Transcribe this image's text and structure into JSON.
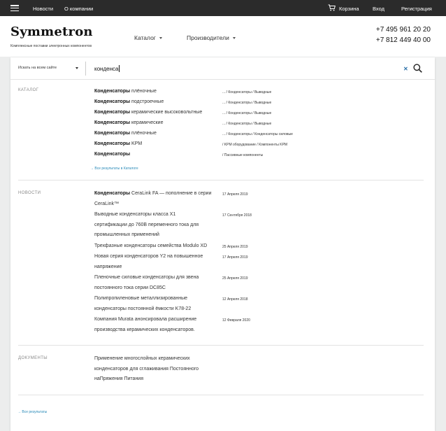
{
  "topbar": {
    "news": "Новости",
    "about": "О компании",
    "cart": "Корзина",
    "login": "Вход",
    "register": "Регистрация"
  },
  "header": {
    "logo": "Symmetron",
    "tagline": "Комплексные поставки электронных компонентов",
    "nav_catalog": "Каталог",
    "nav_manufacturers": "Производители",
    "phone1": "+7 495 961 20 20",
    "phone2": "+7 812 449 40 00"
  },
  "search": {
    "scope": "Искать на всем сайте",
    "query": "конденса"
  },
  "catalog": {
    "label": "КАТАЛОГ",
    "items": [
      {
        "bold": "Конденсаторы",
        "rest": " плёночные",
        "path": "... / Конденсаторы / Выводные"
      },
      {
        "bold": "Конденсаторы",
        "rest": " подстроечные",
        "path": "... / Конденсаторы / Выводные"
      },
      {
        "bold": "Конденсаторы",
        "rest": " керамические высоковольтные",
        "path": "... / Конденсаторы / Выводные"
      },
      {
        "bold": "Конденсаторы",
        "rest": " керамические",
        "path": "... / Конденсаторы / Выводные"
      },
      {
        "bold": "Конденсаторы",
        "rest": " плёночные",
        "path": "... / Конденсаторы / Конденсаторы силовые"
      },
      {
        "bold": "Конденсаторы",
        "rest": " KPM",
        "path": "/ KPM оборудование / Компоненты KPM"
      },
      {
        "bold": "Конденсаторы",
        "rest": "",
        "path": "/ Пассивные компоненты"
      }
    ],
    "all_link": "→ Все результаты в Каталоге"
  },
  "news": {
    "label": "НОВОСТИ",
    "items": [
      {
        "l1a": "Конденсаторы",
        "l1b": " CeraLink FA — пополнение в серии",
        "l2": "CeraLink™",
        "date": "17 Апреля 2019"
      },
      {
        "l1": "Выводные конденсаторы класса X1",
        "l2": "сертификации до 760В переменного тока для",
        "l3": "промышленных применений",
        "date": "17 Сентября 2018"
      },
      {
        "l1": "Трехфазные конденсаторы семейства Modulo XD",
        "date": "25 Апреля 2019"
      },
      {
        "l1": "Новая серия конденсаторов Y2 на повышенное",
        "l2": "напряжение",
        "date": "17 Апреля 2019"
      },
      {
        "l1": "Пленочные силовые конденсаторы для звена",
        "l2": "постоянного тока серии DC85C",
        "date": "25 Апреля 2019"
      },
      {
        "l1": "Полипропиленовые металлизированные",
        "l2": "конденсаторы постоянной ёмкости K78-22",
        "date": "12 Апреля 2018"
      },
      {
        "l1": "Компания Murata анонсировала расширение",
        "l2": "производства керамических конденсаторов.",
        "date": "12 Февраля 2020"
      }
    ]
  },
  "documents": {
    "label": "ДОКУМЕНТЫ",
    "l1": "Применение многослойных керамических",
    "l2": "конденсаторов для сглаживания Постоянного",
    "l3": "наПряжения Питания"
  },
  "all_results": "→ Все результаты",
  "colors": {
    "topbar": "#2b2b2b",
    "link": "#2a8ab8"
  }
}
